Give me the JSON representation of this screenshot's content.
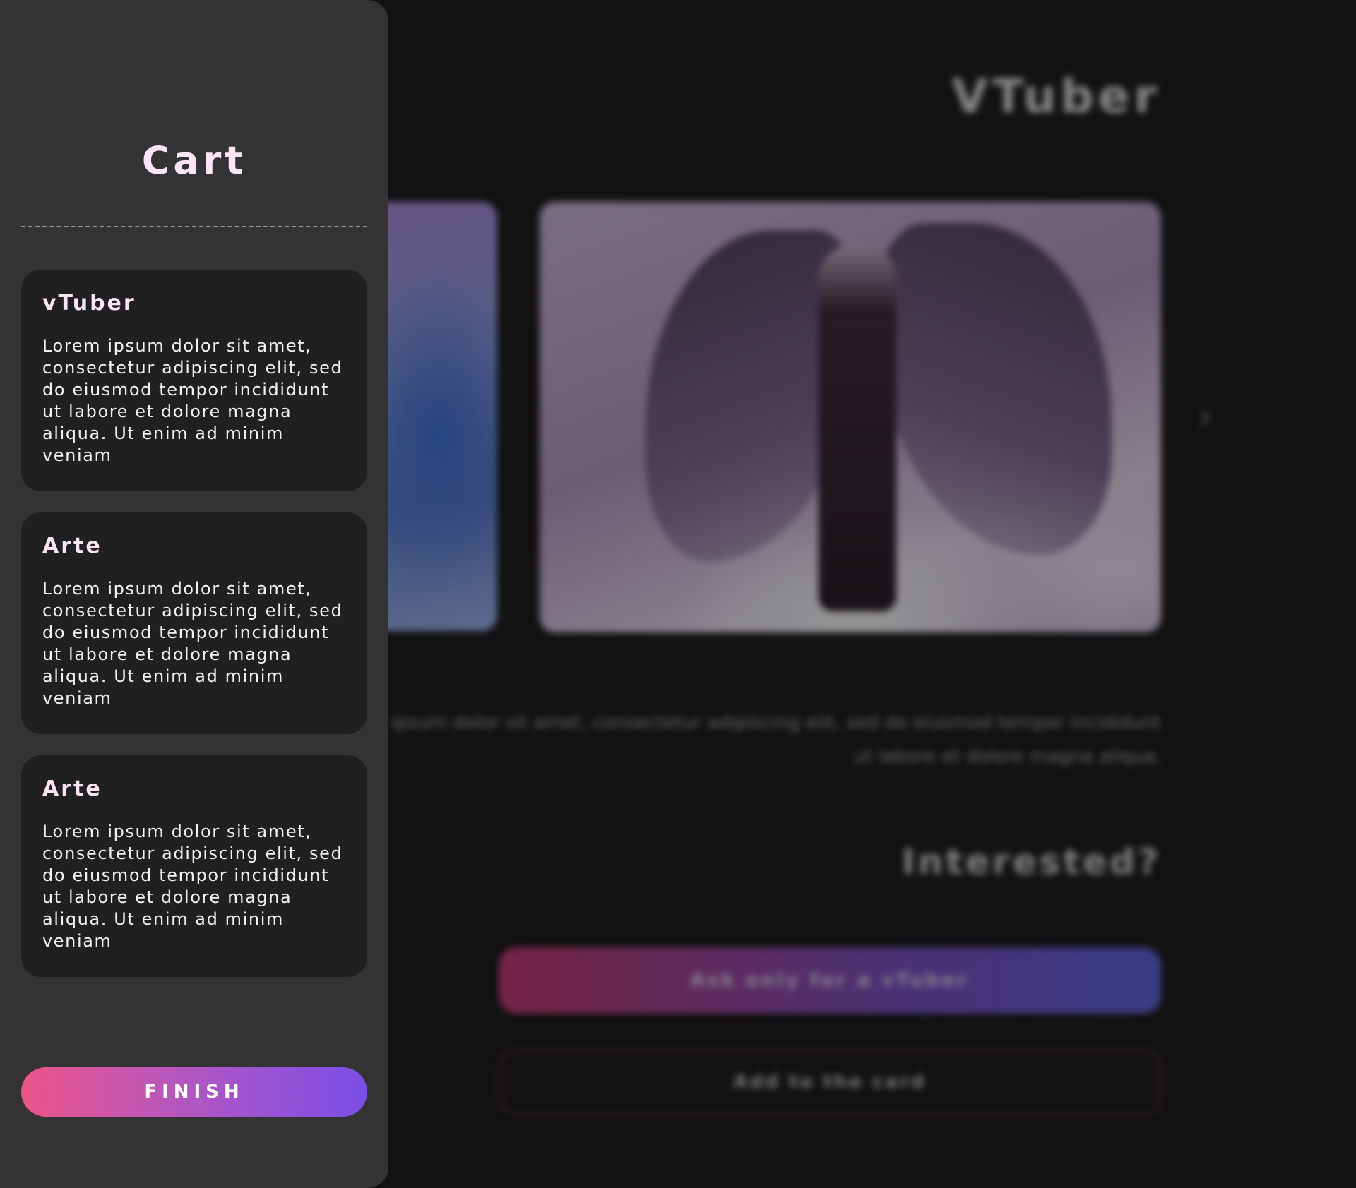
{
  "page": {
    "title": "VTuber",
    "next_icon_glyph": "›",
    "description": "Lorem ipsum dolor sit amet, consectetur adipiscing elit, sed do eiusmod tempor incididunt ut labore et dolore magna aliqua.",
    "interested_heading": "Interested?",
    "ask_button_label": "Ask only for a vTuber",
    "add_to_cart_label": "Add to the card"
  },
  "cart": {
    "title": "Cart",
    "items": [
      {
        "title": "vTuber",
        "text": "Lorem ipsum dolor sit amet, consectetur adipiscing elit, sed do eiusmod tempor incididunt ut labore et dolore magna aliqua. Ut enim ad minim veniam"
      },
      {
        "title": "Arte",
        "text": "Lorem ipsum dolor sit amet, consectetur adipiscing elit, sed do eiusmod tempor incididunt ut labore et dolore magna aliqua. Ut enim ad minim veniam"
      },
      {
        "title": "Arte",
        "text": "Lorem ipsum dolor sit amet, consectetur adipiscing elit, sed do eiusmod tempor incididunt ut labore et dolore magna aliqua. Ut enim ad minim veniam"
      }
    ],
    "finish_label": "FINISH"
  },
  "colors": {
    "panel_bg": "#333333",
    "item_bg": "#202020",
    "title_pink": "#fbe4f3",
    "finish_gradient_start": "#ec5588",
    "finish_gradient_end": "#7b4ee6"
  }
}
